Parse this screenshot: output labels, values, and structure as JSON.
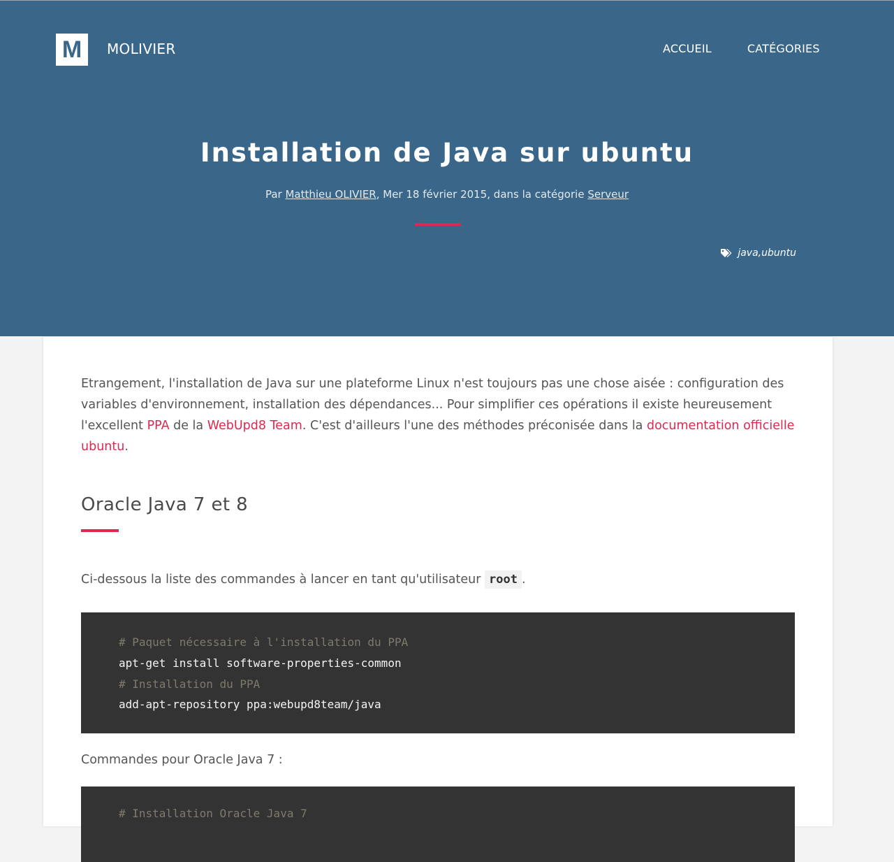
{
  "site": {
    "logo_letter": "M",
    "name": "MOLIVIER"
  },
  "nav": {
    "items": [
      "ACCUEIL",
      "CATÉGORIES"
    ]
  },
  "post": {
    "title": "Installation de Java sur ubuntu",
    "meta": {
      "by": "Par ",
      "author": "Matthieu OLIVIER",
      "date_text": ", Mer 18 février 2015, dans la catégorie ",
      "category": "Serveur"
    },
    "tags": [
      "java",
      "ubuntu"
    ],
    "tags_sep": ", "
  },
  "body": {
    "intro_p1": "Etrangement, l'installation de Java sur une plateforme Linux n'est toujours pas une chose aisée : configuration des variables d'environnement, installation des dépendances... Pour simplifier ces opérations il existe heureusement l'excellent ",
    "link_ppa": "PPA",
    "intro_p2": " de la ",
    "link_team": "WebUpd8 Team",
    "intro_p3": ". C'est d'ailleurs l'une des méthodes préconisée dans la ",
    "link_doc": "documentation officielle ubuntu",
    "intro_p4": ".",
    "section_title": "Oracle Java 7 et 8",
    "commands_intro": "Ci-dessous la liste des commandes à lancer en tant qu'utilisateur ",
    "root_code": "root",
    "commands_intro_end": ".",
    "code_block_1": [
      {
        "type": "comment",
        "text": "# Paquet nécessaire à l'installation du PPA"
      },
      {
        "type": "cmd",
        "text": "apt-get install software-properties-common"
      },
      {
        "type": "comment",
        "text": "# Installation du PPA"
      },
      {
        "type": "cmd",
        "text": "add-apt-repository ppa:webupd8team/java"
      }
    ],
    "java7_label": "Commandes pour Oracle Java 7 :",
    "code_block_2_first": "# Installation Oracle Java 7"
  },
  "colors": {
    "header_bg": "#3a6789",
    "accent": "#e0284e",
    "code_bg": "#333333",
    "code_comment": "#7f7a6e"
  }
}
